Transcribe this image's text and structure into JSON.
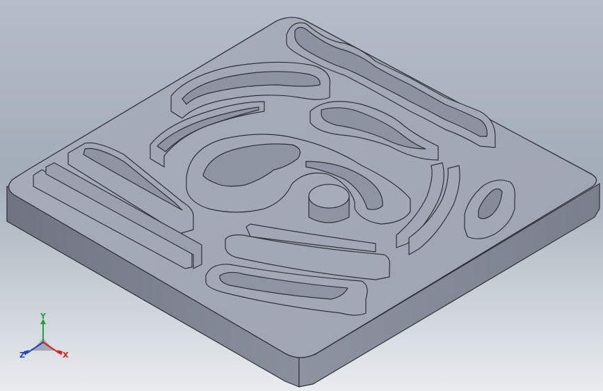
{
  "viewport": {
    "background_top": "#b4bdc8",
    "background_bottom": "#e9ecef"
  },
  "model": {
    "face_color": "#a6abb8",
    "side_color": "#7f8593",
    "edge_color": "#2e3138",
    "slot_color": "#989dab"
  },
  "triad": {
    "y_label": "Y",
    "z_label": "Z",
    "x_label": "X",
    "y_color": "#1fa33a",
    "z_color": "#2a3fc0",
    "x_color": "#d42020"
  }
}
